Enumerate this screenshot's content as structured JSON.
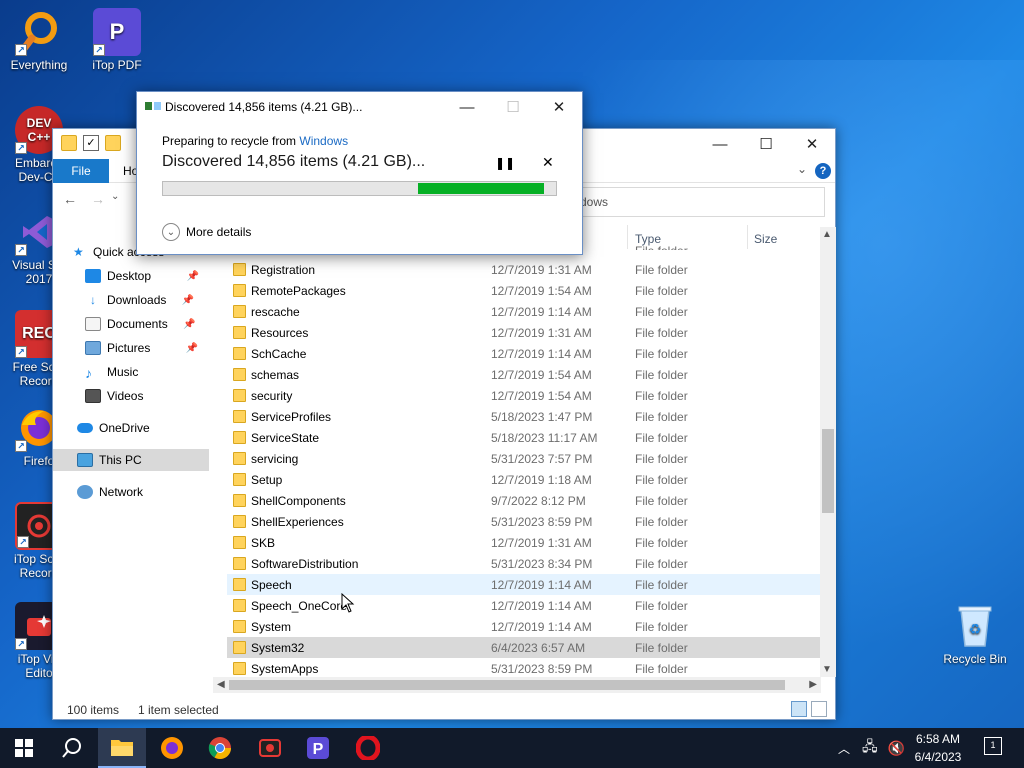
{
  "desktop": {
    "icons": [
      {
        "label": "Everything"
      },
      {
        "label": "iTop PDF"
      },
      {
        "label_lines": [
          "Embarca",
          "Dev-C+"
        ]
      },
      {
        "label_lines": [
          "Visual Stu",
          "2017"
        ]
      },
      {
        "label_lines": [
          "Free Scre",
          "Record"
        ]
      },
      {
        "label": "Firefo"
      },
      {
        "label_lines": [
          "iTop Scre",
          "Record"
        ]
      },
      {
        "label_lines": [
          "iTop Vid",
          "Edito"
        ]
      },
      {
        "label": "Recycle Bin"
      }
    ]
  },
  "explorer": {
    "ribbon": {
      "file_tab": "File",
      "home_tab": "Ho",
      "help": "?"
    },
    "address_partial": "dows",
    "columns": {
      "type": "Type",
      "size": "Size"
    },
    "partial_type": "File folder",
    "sidebar": [
      {
        "label": "Quick access"
      },
      {
        "label": "Desktop"
      },
      {
        "label": "Downloads"
      },
      {
        "label": "Documents"
      },
      {
        "label": "Pictures"
      },
      {
        "label": "Music"
      },
      {
        "label": "Videos"
      },
      {
        "label": "OneDrive"
      },
      {
        "label": "This PC"
      },
      {
        "label": "Network"
      }
    ],
    "rows": [
      {
        "name": "Registration",
        "date": "12/7/2019 1:31 AM",
        "type": "File folder"
      },
      {
        "name": "RemotePackages",
        "date": "12/7/2019 1:54 AM",
        "type": "File folder"
      },
      {
        "name": "rescache",
        "date": "12/7/2019 1:14 AM",
        "type": "File folder"
      },
      {
        "name": "Resources",
        "date": "12/7/2019 1:31 AM",
        "type": "File folder"
      },
      {
        "name": "SchCache",
        "date": "12/7/2019 1:14 AM",
        "type": "File folder"
      },
      {
        "name": "schemas",
        "date": "12/7/2019 1:54 AM",
        "type": "File folder"
      },
      {
        "name": "security",
        "date": "12/7/2019 1:54 AM",
        "type": "File folder"
      },
      {
        "name": "ServiceProfiles",
        "date": "5/18/2023 1:47 PM",
        "type": "File folder"
      },
      {
        "name": "ServiceState",
        "date": "5/18/2023 11:17 AM",
        "type": "File folder"
      },
      {
        "name": "servicing",
        "date": "5/31/2023 7:57 PM",
        "type": "File folder"
      },
      {
        "name": "Setup",
        "date": "12/7/2019 1:18 AM",
        "type": "File folder"
      },
      {
        "name": "ShellComponents",
        "date": "9/7/2022 8:12 PM",
        "type": "File folder"
      },
      {
        "name": "ShellExperiences",
        "date": "5/31/2023 8:59 PM",
        "type": "File folder"
      },
      {
        "name": "SKB",
        "date": "12/7/2019 1:31 AM",
        "type": "File folder"
      },
      {
        "name": "SoftwareDistribution",
        "date": "5/31/2023 8:34 PM",
        "type": "File folder"
      },
      {
        "name": "Speech",
        "date": "12/7/2019 1:14 AM",
        "type": "File folder"
      },
      {
        "name": "Speech_OneCore",
        "date": "12/7/2019 1:14 AM",
        "type": "File folder"
      },
      {
        "name": "System",
        "date": "12/7/2019 1:14 AM",
        "type": "File folder"
      },
      {
        "name": "System32",
        "date": "6/4/2023 6:57 AM",
        "type": "File folder"
      },
      {
        "name": "SystemApps",
        "date": "5/31/2023 8:59 PM",
        "type": "File folder"
      }
    ],
    "status": {
      "items": "100 items",
      "selected": "1 item selected"
    }
  },
  "dialog": {
    "title": "Discovered 14,856 items (4.21 GB)...",
    "preparing_prefix": "Preparing to recycle from ",
    "source_link": "Windows",
    "status": "Discovered 14,856 items (4.21 GB)...",
    "more_details": "More details",
    "progress_fill_start": 0.65,
    "progress_fill_end": 0.97,
    "progress_color": "#06b025"
  },
  "taskbar": {
    "time": "6:58 AM",
    "date": "6/4/2023",
    "notification_count": "1",
    "pinned": [
      "start-icon",
      "search-icon",
      "file-explorer-icon",
      "firefox-icon",
      "chrome-icon",
      "screen-recorder-icon",
      "itop-pdf-icon",
      "opera-icon"
    ]
  },
  "colors": {
    "accent": "#1979ca",
    "progress": "#06b025",
    "selection": "#d9d9d9",
    "hover": "#e5f3ff"
  }
}
